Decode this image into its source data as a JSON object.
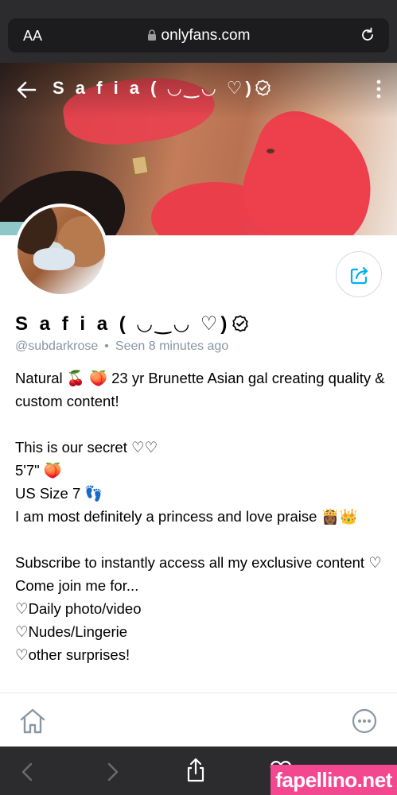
{
  "browser": {
    "text_size_label": "AA",
    "url": "onlyfans.com"
  },
  "cover": {
    "title": "S a f i a ( ◡‿◡ ♡)"
  },
  "profile": {
    "name": "S a f i a ( ◡‿◡ ♡)",
    "username": "@subdarkrose",
    "separator": "•",
    "last_seen": "Seen  8 minutes ago",
    "bio": [
      "Natural 🍒 🍑 23 yr Brunette Asian gal creating quality & custom content!",
      "",
      "This is our secret ♡♡",
      "5'7\" 🍑",
      "US Size 7 👣",
      "I am most definitely a princess and love praise 👸🏾👑",
      "",
      "Subscribe to instantly access all my exclusive content ♡",
      "Come join me for...",
      "♡Daily photo/video",
      "♡Nudes/Lingerie",
      "♡other surprises!"
    ]
  },
  "watermark": "fapellino.net",
  "colors": {
    "accent": "#00aff0",
    "muted": "#8a96a3",
    "watermark_bg": "#f3478f"
  }
}
